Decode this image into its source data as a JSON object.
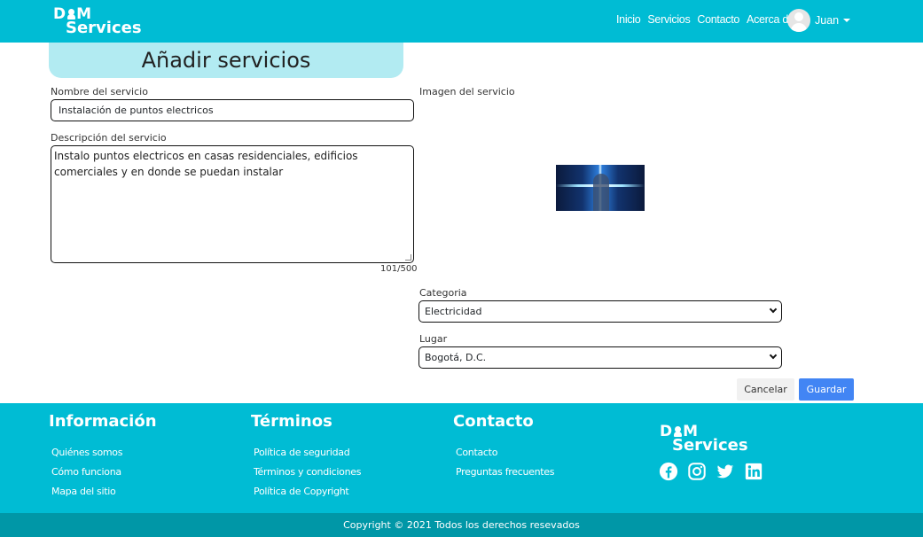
{
  "brand": {
    "line1_a": "D",
    "line1_b": "M",
    "line2": "Services"
  },
  "nav": {
    "items": [
      "Inicio",
      "Servicios",
      "Contacto",
      "Acerca de"
    ],
    "user_name": "Juan"
  },
  "page_title": "Añadir servicios",
  "form": {
    "name_label": "Nombre del servicio",
    "name_value": "Instalación de puntos electricos",
    "description_label": "Descripción del servicio",
    "description_value": "Instalo puntos electricos en casas residenciales, edificios comerciales y en donde se puedan instalar",
    "counter": "101/500",
    "image_label": "Imagen del servicio",
    "category_label": "Categoria",
    "category_value": "Electricidad",
    "place_label": "Lugar",
    "place_value": "Bogotá, D.C.",
    "cancel_label": "Cancelar",
    "save_label": "Guardar"
  },
  "footer": {
    "info": {
      "title": "Información",
      "links": [
        "Quiénes somos",
        "Cómo funciona",
        "Mapa del sitio"
      ]
    },
    "terms": {
      "title": "Términos",
      "links": [
        "Política de seguridad",
        "Términos y condiciones",
        "Política de Copyright"
      ]
    },
    "contact": {
      "title": "Contacto",
      "links": [
        "Contacto",
        "Preguntas frecuentes"
      ]
    },
    "social_icons": [
      "facebook-icon",
      "instagram-icon",
      "twitter-icon",
      "linkedin-icon"
    ],
    "copyright": "Copyright © 2021 Todos los derechos resevados"
  },
  "colors": {
    "primary": "#00bcd4",
    "title_bg": "#b2ebf2",
    "save_button": "#4285f4",
    "copyright_bar": "#0097a7"
  }
}
